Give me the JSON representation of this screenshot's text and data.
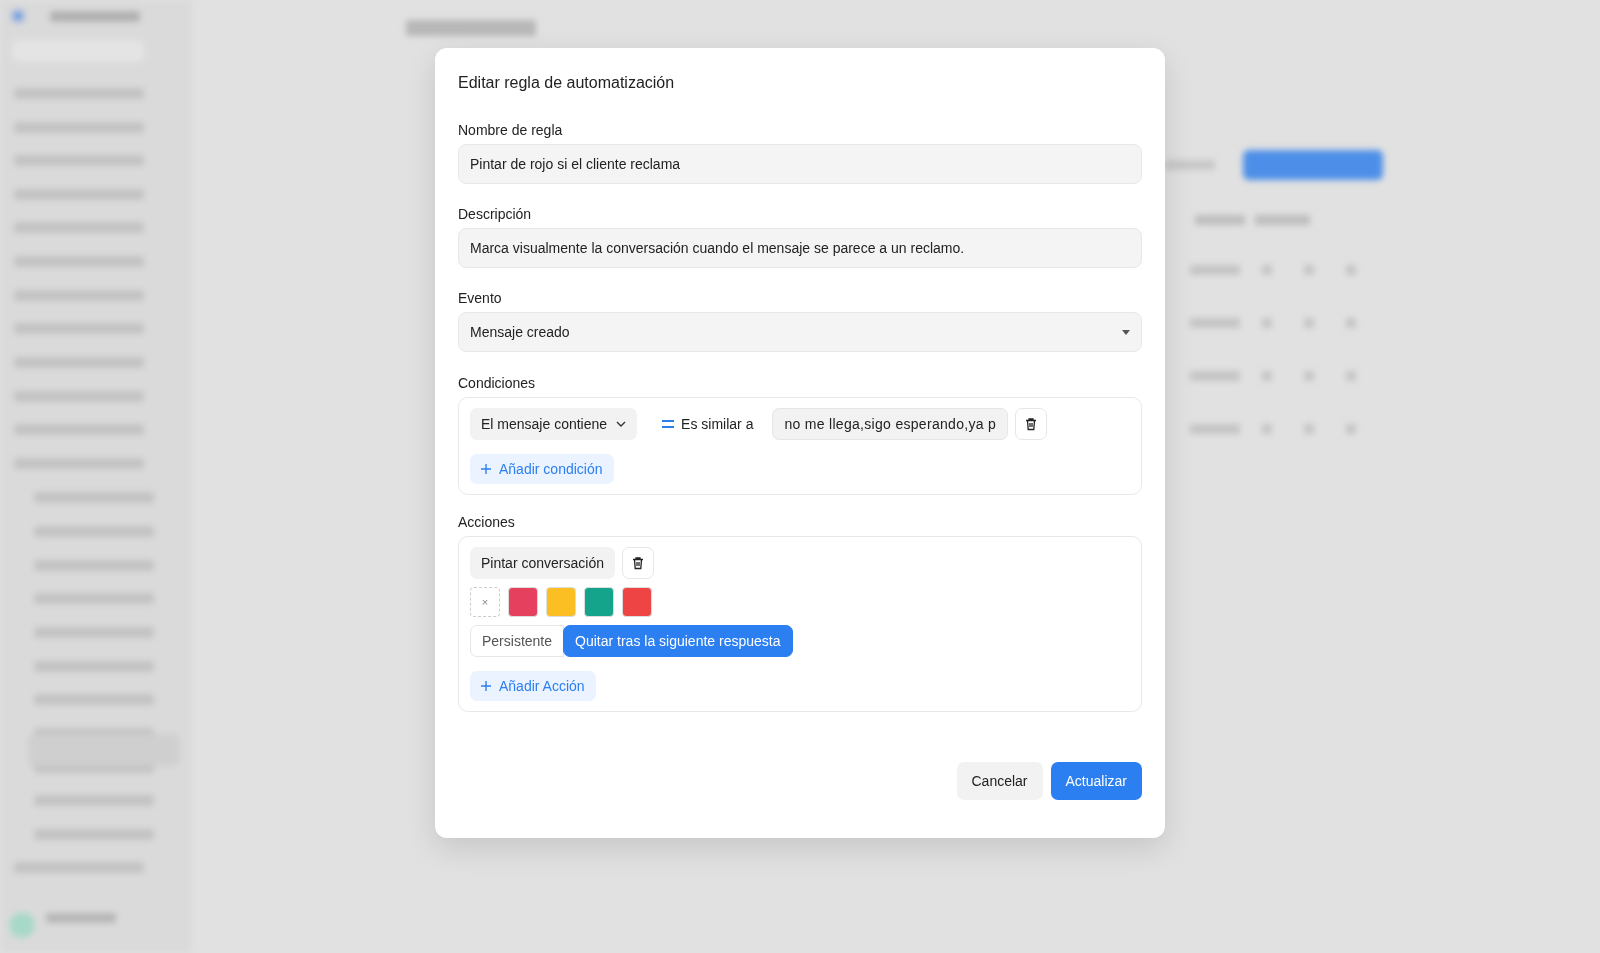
{
  "dialog": {
    "title": "Editar regla de automatización",
    "fields": [
      {
        "label": "Nombre de regla",
        "value": "Pintar de rojo si el cliente reclama",
        "kind": "text"
      },
      {
        "label": "Descripción",
        "value": "Marca visualmente la conversación cuando el mensaje se parece a un reclamo.",
        "kind": "text"
      },
      {
        "label": "Evento",
        "value": "Mensaje creado",
        "kind": "select"
      }
    ],
    "conditions": {
      "label": "Condiciones",
      "items": [
        {
          "attribute": "El mensaje contiene",
          "operator": "Es similar a",
          "value": "no me llega,sigo esperando,ya p"
        }
      ],
      "add_button": "Añadir condición"
    },
    "actions": {
      "label": "Acciones",
      "items": [
        {
          "action": "Pintar conversación",
          "colors": [
            {
              "kind": "none",
              "symbol": "×"
            },
            {
              "kind": "swatch",
              "color": "#e5405e"
            },
            {
              "kind": "swatch",
              "color": "#fbbf24"
            },
            {
              "kind": "swatch",
              "color": "#14a38b"
            },
            {
              "kind": "swatch",
              "color": "#ef4444"
            }
          ],
          "modes": [
            {
              "label": "Persistente",
              "selected": false
            },
            {
              "label": "Quitar tras la siguiente respuesta",
              "selected": true
            }
          ]
        }
      ],
      "add_button": "Añadir Acción"
    },
    "buttons": [
      {
        "label": "Cancelar",
        "kind": "secondary"
      },
      {
        "label": "Actualizar",
        "kind": "primary"
      }
    ]
  }
}
